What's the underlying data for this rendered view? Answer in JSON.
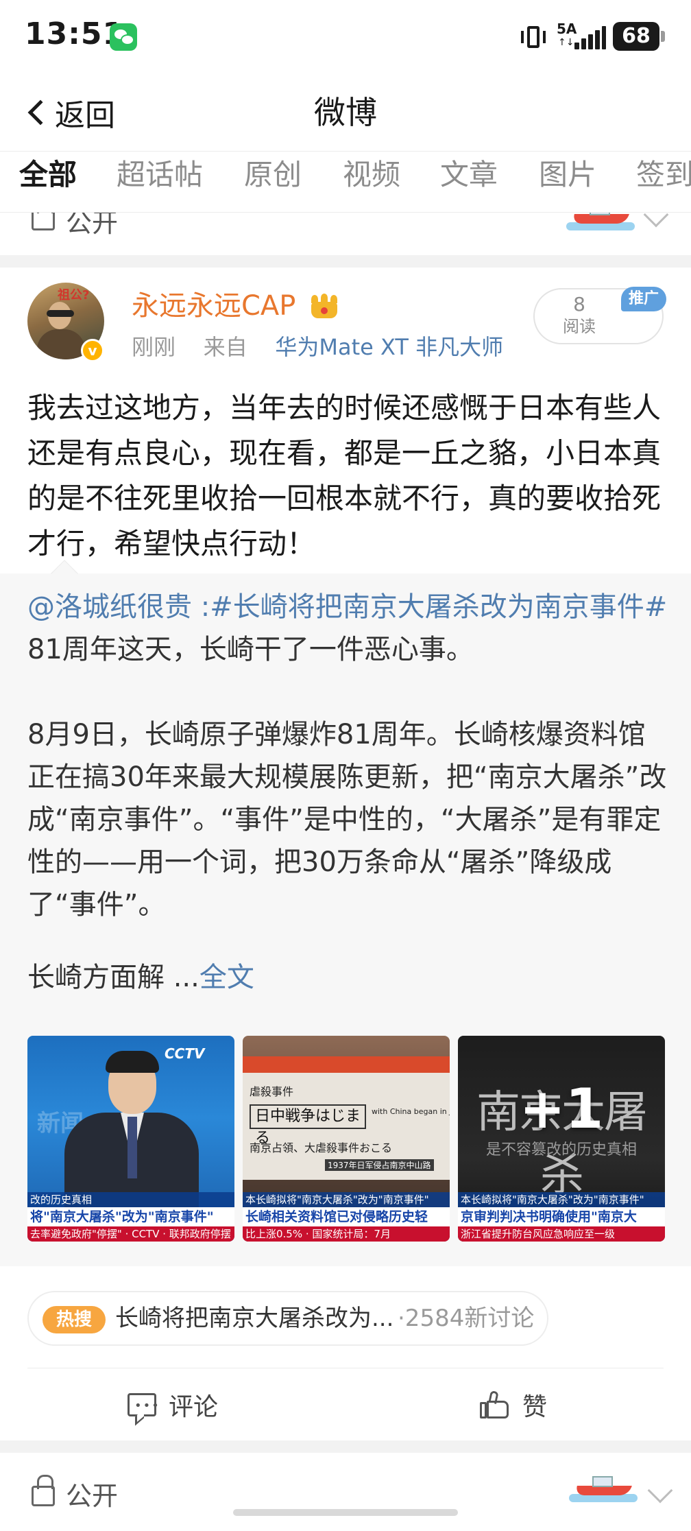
{
  "status_bar": {
    "time": "13:51",
    "network": "5A",
    "network_arrows": "↑↓",
    "battery": "68",
    "icons": [
      "wechat-icon",
      "vibrate-icon",
      "signal-icon",
      "battery-icon"
    ]
  },
  "nav": {
    "back_label": "返回",
    "title": "微博"
  },
  "tabs": [
    {
      "label": "全部",
      "active": true
    },
    {
      "label": "超话帖",
      "active": false
    },
    {
      "label": "原创",
      "active": false
    },
    {
      "label": "视频",
      "active": false
    },
    {
      "label": "文章",
      "active": false
    },
    {
      "label": "图片",
      "active": false
    },
    {
      "label": "签到",
      "active": false
    }
  ],
  "prev_post": {
    "visibility": "公开"
  },
  "post": {
    "author": "永远永远CAP",
    "avatar_caption": "祖公?",
    "time": "刚刚",
    "source_prefix": "来自",
    "source": "华为Mate XT 非凡大师",
    "read_count": "8",
    "read_label": "阅读",
    "ad_badge": "推广",
    "text": "我去过这地方，当年去的时候还感慨于日本有些人还是有点良心，现在看，都是一丘之貉，小日本真的是不往死里收拾一回根本就不行，真的要收拾死才行，希望快点行动！",
    "repost": {
      "mention": "@洛城纸很贵",
      "separator": " :",
      "hashtag": "#长崎将把南京大屠杀改为南京事件#",
      "line1_rest": " 81周年这天，长崎干了一件恶心事。",
      "para2": "8月9日，长崎原子弹爆炸81周年。长崎核爆资料馆正在搞30年来最大规模展陈更新，把“南京大屠杀”改成“南京事件”。“事件”是中性的，“大屠杀”是有罪定性的——用一个词，把30万条命从“屠杀”降级成了“事件”。",
      "para3_text": "长崎方面解 ...",
      "full_text_link": "全文",
      "images": [
        {
          "logo": "CCTV",
          "ghost": "新闻",
          "band_top": "改的历史真相",
          "band_main": "将\"南京大屠杀\"改为\"南京事件\"",
          "ticker": "去率避免政府\"停摆\"  ·  CCTV  ·  联邦政府停摆"
        },
        {
          "paper_lines": [
            "虐殺事件",
            "日中戦争はじまる",
            "with China began in July",
            "南京占領、大虐殺事件おこる",
            "1937年日军侵占南京中山路"
          ],
          "band_top": "本长崎拟将\"南京大屠杀\"改为\"南京事件\"",
          "band_main": "长崎相关资料馆已对侵略历史轻",
          "ticker": "比上涨0.5%  ·  国家统计局：7月"
        },
        {
          "title": "南京大屠杀",
          "subtitle": "是不容篡改的历史真相",
          "band_top": "本长崎拟将\"南京大屠杀\"改为\"南京事件\"",
          "band_main": "京审判判决书明确使用\"南京大",
          "ticker": "浙江省提升防台风应急响应至一级",
          "more": "+1"
        }
      ]
    },
    "hot_topic": {
      "badge": "热搜",
      "text": "长崎将把南京大屠杀改为...",
      "count": "·2584新讨论"
    },
    "actions": {
      "comment": "评论",
      "like": "赞"
    }
  },
  "next_post": {
    "visibility": "公开"
  }
}
